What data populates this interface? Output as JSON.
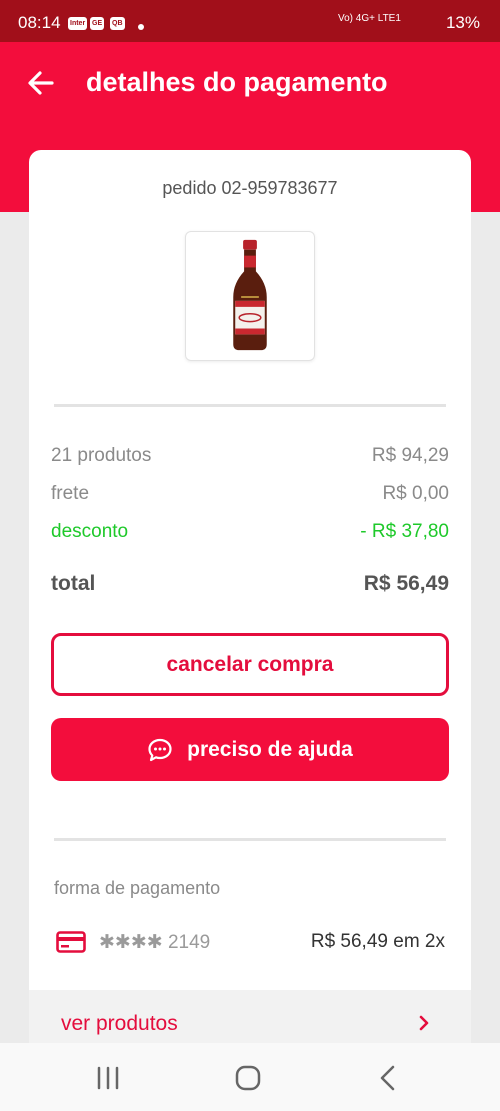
{
  "status_bar": {
    "time": "08:14",
    "notifications": [
      "Inter",
      "GE",
      "QB"
    ],
    "signal_text": "Vo) 4G+ LTE1",
    "battery": "13%"
  },
  "header": {
    "title": "detalhes do pagamento",
    "back_icon": "arrow-left-icon",
    "background_color": "#f30d3c",
    "status_bar_color": "#a10f1a"
  },
  "order": {
    "number": "pedido 02-959783677",
    "product_image": "beer-bottle"
  },
  "summary": {
    "products_label": "21 produtos",
    "products_value": "R$ 94,29",
    "shipping_label": "frete",
    "shipping_value": "R$ 0,00",
    "discount_label": "desconto",
    "discount_value": "- R$ 37,80",
    "discount_color": "#1ec92a",
    "total_label": "total",
    "total_value": "R$ 56,49"
  },
  "actions": {
    "cancel_label": "cancelar compra",
    "help_label": "preciso de ajuda",
    "help_icon": "chat-bubble-icon",
    "accent_color": "#e40d3d"
  },
  "payment": {
    "section_label": "forma de pagamento",
    "card_icon": "credit-card-icon",
    "card_masked": "✱✱✱✱ 2149",
    "amount": "R$ 56,49 em 2x"
  },
  "products_link": {
    "label": "ver produtos",
    "icon": "chevron-right-icon"
  },
  "nav": {
    "items": [
      "recent-apps-icon",
      "home-icon",
      "back-icon"
    ]
  }
}
